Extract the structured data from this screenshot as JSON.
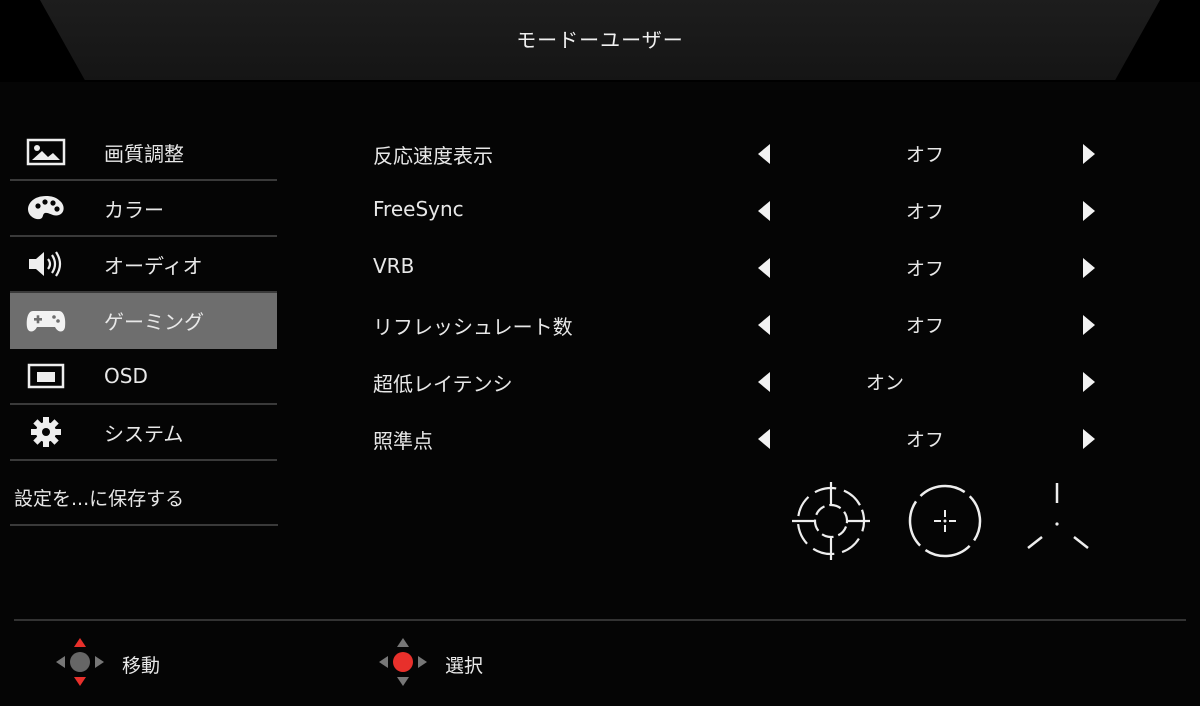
{
  "header": {
    "title": "モードーユーザー"
  },
  "sidebar": {
    "items": [
      {
        "label": "画質調整",
        "icon": "picture-icon",
        "selected": false
      },
      {
        "label": "カラー",
        "icon": "palette-icon",
        "selected": false
      },
      {
        "label": "オーディオ",
        "icon": "speaker-icon",
        "selected": false
      },
      {
        "label": "ゲーミング",
        "icon": "gamepad-icon",
        "selected": true
      },
      {
        "label": "OSD",
        "icon": "osd-icon",
        "selected": false
      },
      {
        "label": "システム",
        "icon": "gear-icon",
        "selected": false
      }
    ],
    "save_label": "設定を...に保存する"
  },
  "settings": [
    {
      "label": "反応速度表示",
      "value": "オフ"
    },
    {
      "label": "FreeSync",
      "value": "オフ"
    },
    {
      "label": "VRB",
      "value": "オフ"
    },
    {
      "label": "リフレッシュレート数",
      "value": "オフ"
    },
    {
      "label": "超低レイテンシ",
      "value": "オン"
    },
    {
      "label": "照準点",
      "value": "オフ"
    }
  ],
  "crosshair_options": [
    "crosshair-scope-icon",
    "crosshair-circle-icon",
    "crosshair-tri-icon"
  ],
  "footer": {
    "move_label": "移動",
    "select_label": "選択"
  },
  "colors": {
    "accent": "#e8302b",
    "selected_bg": "#6e6e6e"
  }
}
